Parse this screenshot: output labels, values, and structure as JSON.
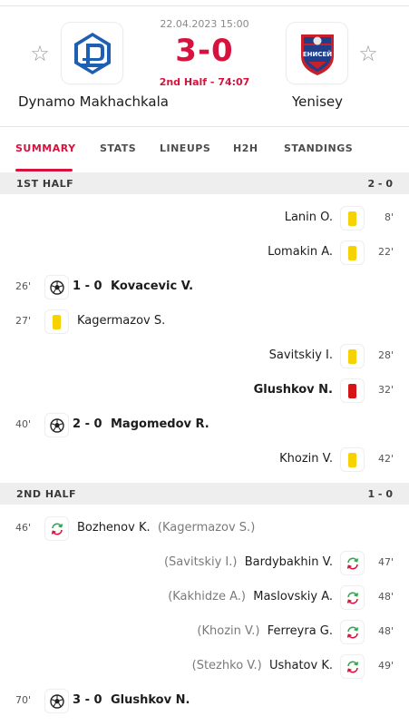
{
  "match": {
    "datetime": "22.04.2023 15:00",
    "score": "3-0",
    "status": "2nd Half - 74:07",
    "home": {
      "name": "Dynamo Makhachkala",
      "logo": "dynamo-logo-icon"
    },
    "away": {
      "name": "Yenisey",
      "logo": "yenisey-logo-icon",
      "logo_text": "ЕНИСЕЙ"
    }
  },
  "tabs": [
    {
      "label": "SUMMARY",
      "active": true
    },
    {
      "label": "STATS"
    },
    {
      "label": "LINEUPS"
    },
    {
      "label": "H2H"
    },
    {
      "label": "STANDINGS"
    }
  ],
  "sections": [
    {
      "title": "1ST HALF",
      "score": "2 - 0"
    },
    {
      "title": "2ND HALF",
      "score": "1 - 0"
    }
  ],
  "events": [
    {
      "side": "away",
      "minute": "8'",
      "type": "yellow-card",
      "player": "Lanin O."
    },
    {
      "side": "away",
      "minute": "22'",
      "type": "yellow-card",
      "player": "Lomakin A."
    },
    {
      "side": "home",
      "minute": "26'",
      "type": "goal",
      "score": "1 - 0",
      "player": "Kovacevic V."
    },
    {
      "side": "home",
      "minute": "27'",
      "type": "yellow-card",
      "player": "Kagermazov S."
    },
    {
      "side": "away",
      "minute": "28'",
      "type": "yellow-card",
      "player": "Savitskiy I."
    },
    {
      "side": "away",
      "minute": "32'",
      "type": "red-card",
      "player": "Glushkov N."
    },
    {
      "side": "home",
      "minute": "40'",
      "type": "goal",
      "score": "2 - 0",
      "player": "Magomedov R."
    },
    {
      "side": "away",
      "minute": "42'",
      "type": "yellow-card",
      "player": "Khozin V."
    },
    {
      "side": "home",
      "minute": "46'",
      "type": "substitution",
      "player": "Bozhenov K.",
      "assist": "(Kagermazov S.)"
    },
    {
      "side": "away",
      "minute": "47'",
      "type": "substitution",
      "player": "Bardybakhin V.",
      "assist": "(Savitskiy I.)"
    },
    {
      "side": "away",
      "minute": "48'",
      "type": "substitution",
      "player": "Maslovskiy A.",
      "assist": "(Kakhidze A.)"
    },
    {
      "side": "away",
      "minute": "48'",
      "type": "substitution",
      "player": "Ferreyra G.",
      "assist": "(Khozin V.)"
    },
    {
      "side": "away",
      "minute": "49'",
      "type": "substitution",
      "player": "Ushatov K.",
      "assist": "(Stezhko V.)"
    },
    {
      "side": "home",
      "minute": "70'",
      "type": "goal",
      "score": "3 - 0",
      "player": "Glushkov N."
    }
  ],
  "colors": {
    "accent": "#d8123e",
    "yellow_card": "#f5d200",
    "red_card": "#d51515",
    "sub_in": "#2fa84f",
    "sub_out": "#d8123e"
  }
}
